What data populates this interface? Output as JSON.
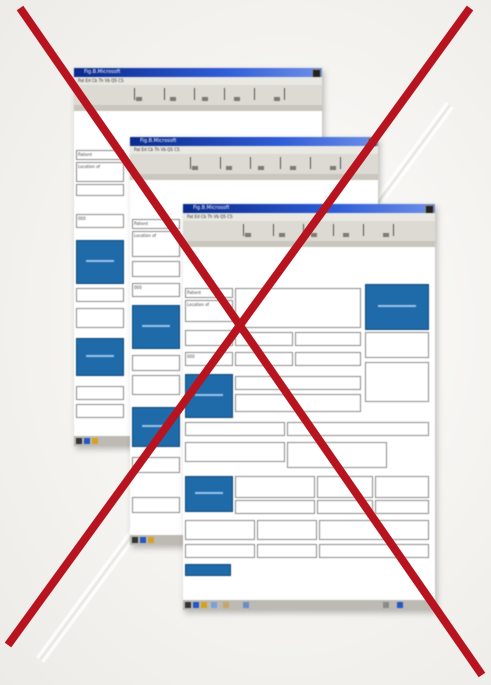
{
  "screenshots": [
    {
      "title": "Fig.B.Microsoft",
      "toolbar": "Pat  Ed  Cb  Th  Vb  QS  CS",
      "field_label_1": "Patient",
      "field_label_2": "Location of",
      "field_value": "000"
    },
    {
      "title": "Fig.B.Microsoft",
      "toolbar": "Pat  Ed  Cb  Th  Vb  QS  CS",
      "field_label_1": "Patient",
      "field_label_2": "Location of",
      "field_value": "000"
    },
    {
      "title": "Fig.B.Microsoft",
      "toolbar": "Pat  Ed  Cb  Th  Vb  QS  CS",
      "field_label_1": "Patient",
      "field_label_2": "Location of",
      "field_value": "000"
    }
  ],
  "overlay": {
    "cross_color": "#b8141f",
    "icon": "x-mark-icon"
  }
}
